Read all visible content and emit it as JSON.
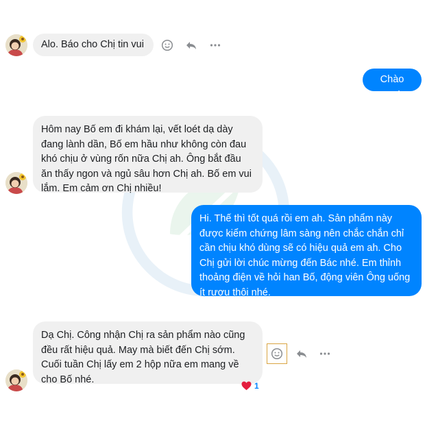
{
  "conversation": {
    "messages": [
      {
        "sender": "contact",
        "text": "Alo. Báo cho Chị tin vui"
      },
      {
        "sender": "me",
        "text": "Chào em!"
      },
      {
        "sender": "contact",
        "text": "Hôm nay Bố em đi khám lại, vết loét dạ dày đang lành dần, Bố em hầu như không còn đau khó chịu ở vùng rốn nữa Chị ah. Ông bắt đầu ăn thấy ngon và ngủ sâu hơn Chị ah. Bố em vui lắm. Em cảm ơn Chị nhiều!"
      },
      {
        "sender": "me",
        "text": "Hi. Thế thì tốt quá rồi em ah. Sản phẩm này được kiểm chứng lâm sàng nên chắc chắn chỉ cần chịu khó dùng sẽ có hiệu quả em ah. Cho Chị gửi lời chúc mừng đến Bác nhé. Em thỉnh thoảng điện về hỏi han Bố, động viên Ông uống ít rượu thôi nhé."
      },
      {
        "sender": "contact",
        "text": "Dạ Chị. Công nhận Chị ra sản phẩm nào cũng đều rất hiệu quả. May mà biết đến Chị sớm. Cuối tuần Chị lấy em 2 hộp nữa em mang về cho Bố nhé."
      }
    ],
    "reaction": {
      "icon": "heart-icon",
      "count": "1"
    },
    "icons": {
      "react": "smiley-icon",
      "reply": "reply-icon",
      "more": "more-icon"
    },
    "colors": {
      "outgoing": "#0084ff",
      "incoming": "#f0f0f0",
      "reaction": "#e41e3f"
    }
  }
}
